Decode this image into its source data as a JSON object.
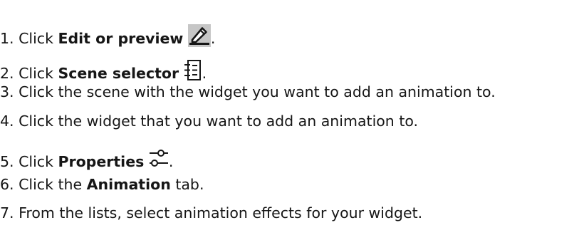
{
  "steps": [
    {
      "number": "1.",
      "prefix": "Click ",
      "bold": "Edit or preview",
      "icon": "pencil-edit-icon",
      "suffix": "."
    },
    {
      "number": "2.",
      "prefix": "Click ",
      "bold": "Scene selector",
      "icon": "scene-list-icon",
      "suffix": "."
    },
    {
      "number": "3.",
      "text": "Click the scene with the widget you want to add an animation to."
    },
    {
      "number": "4.",
      "text": "Click the widget that you want to add an animation to."
    },
    {
      "number": "5.",
      "prefix": "Click ",
      "bold": "Properties",
      "icon": "properties-slider-icon",
      "suffix": "."
    },
    {
      "number": "6.",
      "prefix": "Click the ",
      "bold": "Animation",
      "suffix": " tab."
    },
    {
      "number": "7.",
      "text": "From the lists, select animation effects for your widget."
    }
  ]
}
